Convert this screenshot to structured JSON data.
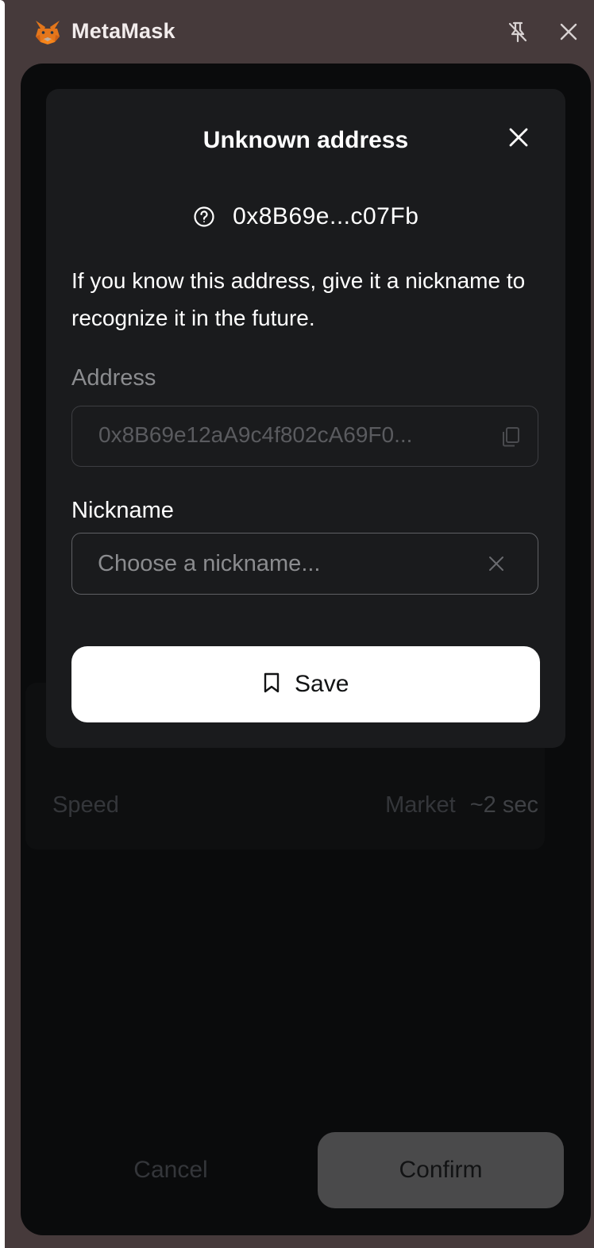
{
  "window": {
    "app_title": "MetaMask",
    "logo_icon": "metamask-fox-icon",
    "pin_icon": "unpin-icon",
    "close_icon": "close-icon"
  },
  "modal": {
    "title": "Unknown address",
    "short_address": "0x8B69e...c07Fb",
    "description": "If you know this address, give it a nickname to recognize it in the future.",
    "address_label": "Address",
    "address_value": "0x8B69e12aA9c4f802cA69F0...",
    "nickname_label": "Nickname",
    "nickname_placeholder": "Choose a nickname...",
    "nickname_value": "",
    "save_label": "Save"
  },
  "background": {
    "speed_label": "Speed",
    "speed_mode": "Market",
    "speed_time": "~2 sec",
    "cancel_label": "Cancel",
    "confirm_label": "Confirm"
  },
  "colors": {
    "window_bg": "#463a3b",
    "app_bg": "#0a0b0c",
    "modal_bg": "#1a1b1d",
    "save_bg": "#ffffff",
    "confirm_bg": "#4a4a4b"
  }
}
